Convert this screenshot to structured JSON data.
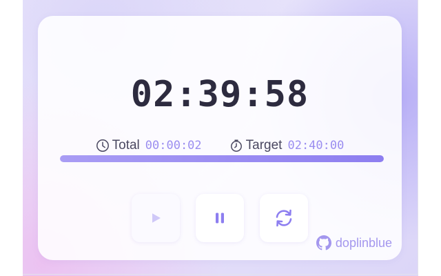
{
  "timer": {
    "remaining": "02:39:58"
  },
  "stats": {
    "total_label": "Total",
    "total_value": "00:00:02",
    "target_label": "Target",
    "target_value": "02:40:00"
  },
  "progress": {
    "fraction": 0.999
  },
  "controls": {
    "play": {
      "icon": "play-icon",
      "enabled": false
    },
    "pause": {
      "icon": "pause-icon",
      "enabled": true
    },
    "reset": {
      "icon": "reset-icon",
      "enabled": true
    }
  },
  "credit": {
    "icon": "github-icon",
    "text": "doplinblue"
  },
  "colors": {
    "accent": "#8d7ef0",
    "accent_light": "#a497ee",
    "text_dark": "#2d2b3f"
  }
}
